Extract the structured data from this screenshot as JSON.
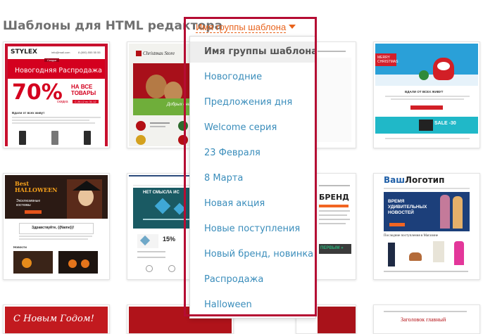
{
  "page": {
    "heading": "Шаблоны для HTML редактора"
  },
  "group_selector": {
    "label": "Имя группы шаблона",
    "options": [
      "Имя группы шаблона",
      "Новогодние",
      "Предложения дня",
      "Welcome серия",
      "23 Февраля",
      "8 Марта",
      "Новая акция",
      "Новые поступления",
      "Новый бренд, новинка",
      "Распродажа",
      "Halloween"
    ],
    "selected": "Имя группы шаблона"
  },
  "templates": {
    "stylex": {
      "logo": "STYLEX",
      "email": "info@mail.com",
      "phone": "8 (800) 555 55 55",
      "banner": "Новогодняя Распродажа",
      "badge": "Скидки",
      "percent": "70%",
      "discount_word": "скидка",
      "all_goods": "НА ВСЕ ТОВАРЫ",
      "dates": "С 26.12 по 31.12",
      "section": "Вдали от всех живут"
    },
    "christmas_store": {
      "logo": "Christmas Store",
      "promo": "Добрых дней,"
    },
    "merry_christmas": {
      "badge": "MERRY CHRISTMAS",
      "headline": "ВДАЛИ ОТ ВСЕХ ЖИВУТ",
      "sale": "SALE -30"
    },
    "halloween": {
      "title": "Best HALLOWEEN",
      "subtitle": "Эксклюзивные костюмы",
      "greeting": "Здравствуйте, {{Name}}!",
      "news": "Новости"
    },
    "no_sense": {
      "headline": "НЕТ СМЫСЛА ИС",
      "percent": "15%"
    },
    "brand": {
      "label": "БРЕНД",
      "button": "ПЕРВЫМ »"
    },
    "logo_template": {
      "logo_prefix": "Ваш",
      "logo_suffix": "Логотип",
      "banner": "ВРЕМЯ УДИВИТЕЛЬНЫХ НОВОСТЕЙ",
      "caption": "Последние поступления в Магазине"
    },
    "bottom": {
      "new_year": "С Новым Годом!",
      "headline": "Заголовок главный"
    }
  }
}
